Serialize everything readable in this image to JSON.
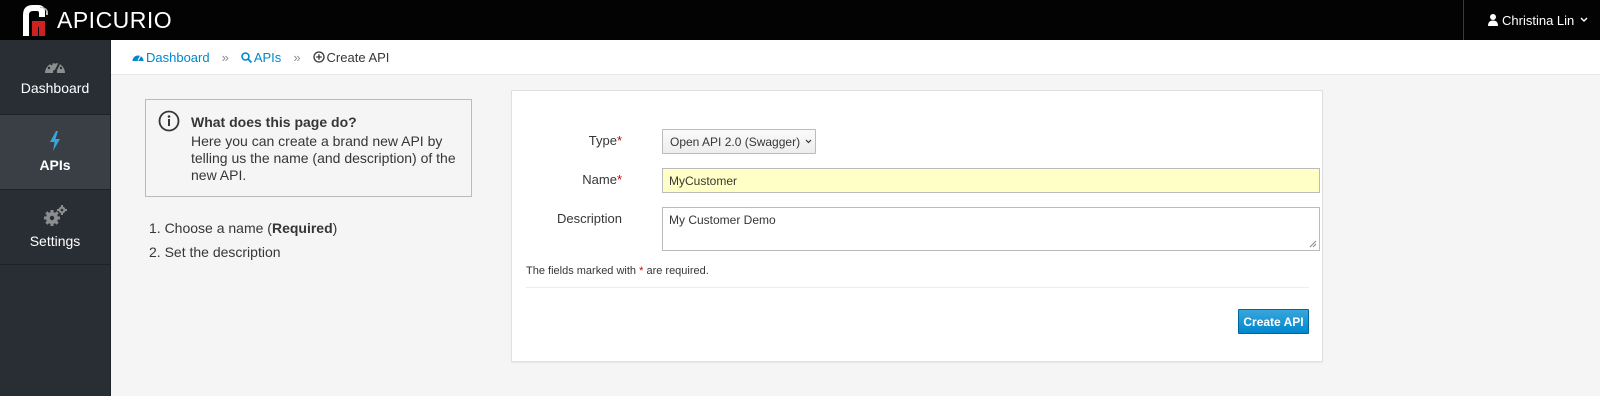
{
  "app": {
    "brand": "APICURIO",
    "user_name": "Christina Lin"
  },
  "sidebar": {
    "items": [
      {
        "label": "Dashboard",
        "icon": "dashboard-icon",
        "active": false
      },
      {
        "label": "APIs",
        "icon": "bolt-icon",
        "active": true
      },
      {
        "label": "Settings",
        "icon": "gears-icon",
        "active": false
      }
    ]
  },
  "breadcrumb": {
    "items": [
      {
        "label": "Dashboard",
        "icon": "dashboard-icon"
      },
      {
        "label": "APIs",
        "icon": "search-icon"
      },
      {
        "label": "Create API",
        "icon": "plus-circle-icon"
      }
    ],
    "separator": "»"
  },
  "info": {
    "title": "What does this page do?",
    "body": "Here you can create a brand new API by telling us the name (and description) of the new API."
  },
  "steps": {
    "step1_prefix": "1. Choose a name (",
    "step1_bold": "Required",
    "step1_suffix": ")",
    "step2": "2. Set the description"
  },
  "form": {
    "type_label": "Type",
    "type_value": "Open API 2.0 (Swagger)",
    "name_label": "Name",
    "name_value": "MyCustomer",
    "description_label": "Description",
    "description_value": "My Customer Demo",
    "required_marker": "*",
    "required_note_prefix": "The fields marked with ",
    "required_note_suffix": " are required.",
    "submit_label": "Create API"
  },
  "colors": {
    "topbar": "#030303",
    "sidebar": "#292e34",
    "link": "#0088ce",
    "primary": "#0088ce",
    "name_field_bg": "#ffffc6",
    "required": "#c00000"
  }
}
